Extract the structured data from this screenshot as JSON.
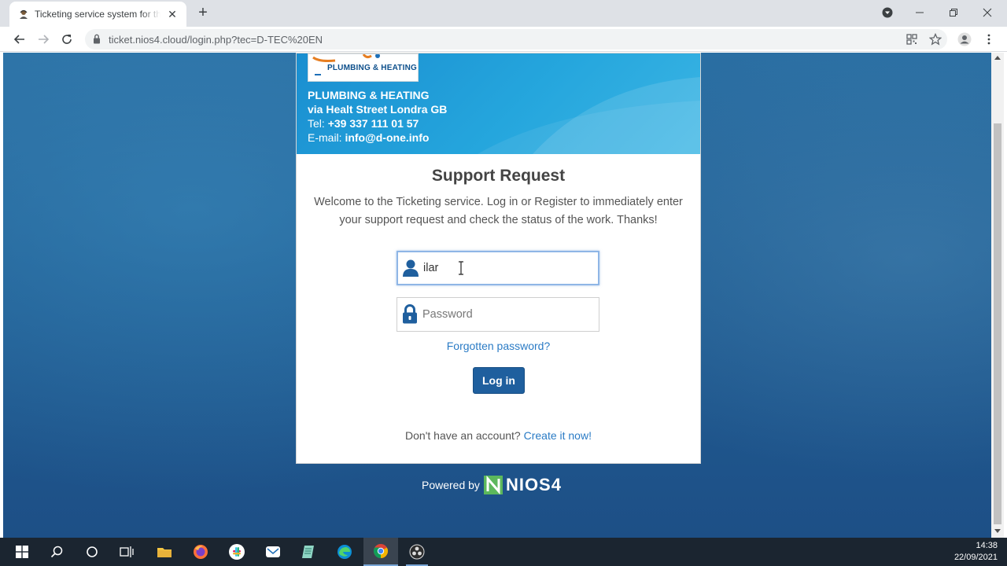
{
  "browser": {
    "tab_title": "Ticketing service system for the customers",
    "url": "ticket.nios4.cloud/login.php?tec=D-TEC%20EN",
    "new_tab_label": "+"
  },
  "page": {
    "logo_text": "PLUMBING & HEATING",
    "company": {
      "name": "PLUMBING & HEATING",
      "address": "via Healt Street Londra GB",
      "tel_label": "Tel: ",
      "tel_value": "+39 337 111 01 57",
      "email_label": "E-mail: ",
      "email_value": "info@d-one.info"
    },
    "title": "Support Request",
    "description": "Welcome to the Ticketing service. Log in or Register to immediately enter your support request and check the status of the work. Thanks!",
    "username_value": "ilar",
    "password_placeholder": "Password",
    "forgot_link": "Forgotten password?",
    "login_button": "Log in",
    "register_prompt": "Don't have an account? ",
    "register_link": "Create it now!",
    "powered_label": "Powered by",
    "powered_brand": "NIOS4"
  },
  "taskbar": {
    "time": "14:38",
    "date": "22/09/2021"
  },
  "colors": {
    "header_blue": "#25a6dd",
    "button_blue": "#1f5f9e",
    "link_blue": "#2a7bc5",
    "nios_green": "#5cb85c"
  }
}
